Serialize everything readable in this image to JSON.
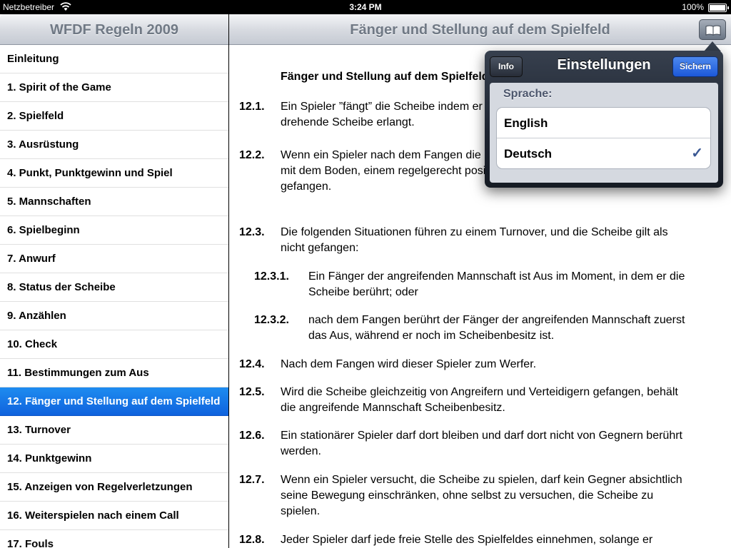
{
  "status_bar": {
    "carrier": "Netzbetreiber",
    "time": "3:24 PM",
    "battery": "100%"
  },
  "master": {
    "title": "WFDF Regeln 2009",
    "items": [
      "Einleitung",
      "1. Spirit of the Game",
      "2. Spielfeld",
      "3. Ausrüstung",
      "4. Punkt, Punktgewinn und Spiel",
      "5. Mannschaften",
      "6. Spielbeginn",
      "7. Anwurf",
      "8. Status der Scheibe",
      "9. Anzählen",
      "10. Check",
      "11. Bestimmungen zum Aus",
      "12. Fänger und Stellung auf dem Spielfeld",
      "13. Turnover",
      "14. Punktgewinn",
      "15. Anzeigen von Regelverletzungen",
      "16. Weiterspielen nach einem Call",
      "17. Fouls"
    ],
    "selected_index": 12
  },
  "detail": {
    "title": "Fänger und Stellung auf dem Spielfeld",
    "heading": "Fänger und Stellung auf dem Spielfeld",
    "rules": [
      {
        "num": "12.1.",
        "text": "Ein Spieler ”fängt” die Scheibe indem er die volle Kontrolle über die sich nicht drehende Scheibe erlangt."
      },
      {
        "num": "12.2.",
        "text": "Wenn ein Spieler nach dem Fangen die Scheibe verliert aufgrund von Kontakt mit dem Boden, einem regelgerecht positionierten Gegner, ist die Scheibe nicht gefangen."
      },
      {
        "num": "12.3.",
        "text": "Die folgenden Situationen führen zu einem Turnover, und die Scheibe gilt als nicht gefangen:"
      },
      {
        "num": "12.3.1.",
        "text": "Ein Fänger der angreifenden Mannschaft ist Aus im Moment, in dem er die Scheibe berührt; oder"
      },
      {
        "num": "12.3.2.",
        "text": "nach dem Fangen berührt der Fänger der angreifenden Mannschaft zuerst das Aus, während er noch im Scheibenbesitz ist."
      },
      {
        "num": "12.4.",
        "text": "Nach dem Fangen wird dieser Spieler zum Werfer."
      },
      {
        "num": "12.5.",
        "text": "Wird die Scheibe gleichzeitig von Angreifern und Verteidigern gefangen, behält die angreifende Mannschaft Scheibenbesitz."
      },
      {
        "num": "12.6.",
        "text": "Ein stationärer Spieler darf dort bleiben und darf dort nicht von Gegnern berührt werden."
      },
      {
        "num": "12.7.",
        "text": "Wenn ein Spieler versucht, die Scheibe zu spielen, darf kein Gegner absichtlich seine Bewegung einschränken, ohne selbst zu versuchen, die Scheibe zu spielen."
      },
      {
        "num": "12.8.",
        "text": "Jeder Spieler darf jede freie Stelle des Spielfeldes einnehmen, solange er dadurch nicht eine Berührung verursacht."
      }
    ]
  },
  "popover": {
    "title": "Einstellungen",
    "info_label": "Info",
    "save_label": "Sichern",
    "section_header": "Sprache:",
    "options": [
      "English",
      "Deutsch"
    ],
    "selected_option": "Deutsch",
    "checkmark": "✓"
  },
  "colors": {
    "selection": "#1a7ee8",
    "save_button": "#2f6ee2"
  }
}
